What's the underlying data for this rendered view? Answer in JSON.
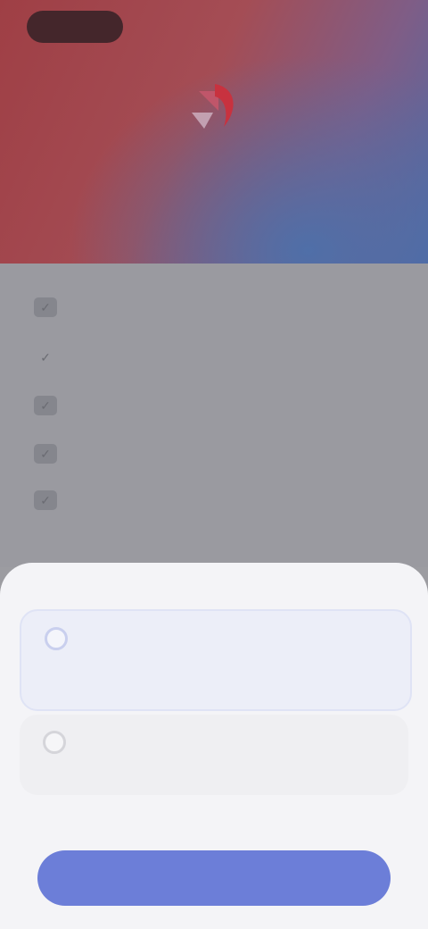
{
  "header": {
    "back_label": "",
    "restore_label": "",
    "logo_icon": "brand-logo-icon",
    "title_line1": "",
    "title_line2": ""
  },
  "features": [
    {
      "label": "",
      "icon": "check-icon"
    },
    {
      "label": "",
      "icon": "check-icon"
    },
    {
      "label": "",
      "icon": "check-icon"
    },
    {
      "label": "",
      "icon": "check-icon"
    },
    {
      "label": "",
      "icon": "check-icon"
    }
  ],
  "plans": [
    {
      "name": "",
      "price": "",
      "subtext": "",
      "selected": true
    },
    {
      "name": "",
      "price": "",
      "subtext": "",
      "selected": false
    }
  ],
  "terms_text": "",
  "cta_label": "",
  "colors": {
    "accent": "#6c7ed8",
    "hero_red": "#9f3f45",
    "hero_blue": "#4e6aa6",
    "sheet": "#f4f4f7"
  }
}
